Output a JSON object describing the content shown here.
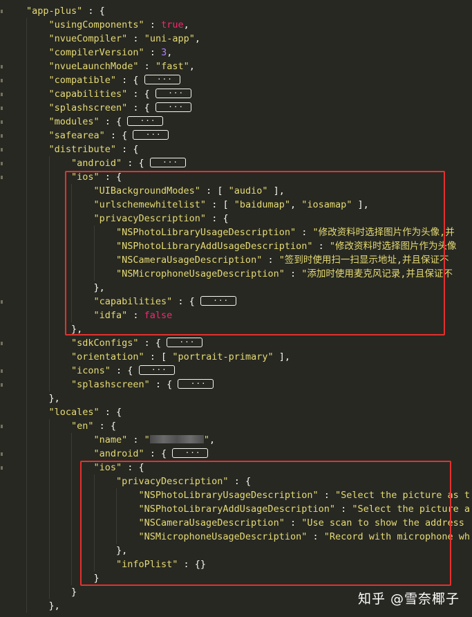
{
  "editor": {
    "theme": {
      "background": "#272822",
      "key": "#e6db74",
      "string": "#e6db74",
      "number": "#ae81ff",
      "keyword": "#f92672",
      "punctuation": "#f8f8f2",
      "highlight": "#e5312f"
    },
    "fold_marker": " ···",
    "lines": [
      {
        "indent": 1,
        "tokens": [
          {
            "c": "key",
            "v": "\"app-plus\""
          },
          {
            "c": "pun",
            "v": " : {"
          }
        ]
      },
      {
        "indent": 2,
        "tokens": [
          {
            "c": "key",
            "v": "\"usingComponents\""
          },
          {
            "c": "pun",
            "v": " : "
          },
          {
            "c": "kw",
            "v": "true"
          },
          {
            "c": "pun",
            "v": ","
          }
        ]
      },
      {
        "indent": 2,
        "tokens": [
          {
            "c": "key",
            "v": "\"nvueCompiler\""
          },
          {
            "c": "pun",
            "v": " : "
          },
          {
            "c": "str",
            "v": "\"uni-app\""
          },
          {
            "c": "pun",
            "v": ","
          }
        ]
      },
      {
        "indent": 2,
        "tokens": [
          {
            "c": "key",
            "v": "\"compilerVersion\""
          },
          {
            "c": "pun",
            "v": " : "
          },
          {
            "c": "num",
            "v": "3"
          },
          {
            "c": "pun",
            "v": ","
          }
        ]
      },
      {
        "indent": 2,
        "tokens": [
          {
            "c": "key",
            "v": "\"nvueLaunchMode\""
          },
          {
            "c": "pun",
            "v": " : "
          },
          {
            "c": "str",
            "v": "\"fast\""
          },
          {
            "c": "pun",
            "v": ","
          }
        ]
      },
      {
        "indent": 2,
        "tokens": [
          {
            "c": "key",
            "v": "\"compatible\""
          },
          {
            "c": "pun",
            "v": " : { "
          },
          {
            "c": "fold"
          }
        ]
      },
      {
        "indent": 2,
        "tokens": [
          {
            "c": "key",
            "v": "\"capabilities\""
          },
          {
            "c": "pun",
            "v": " : { "
          },
          {
            "c": "fold"
          }
        ]
      },
      {
        "indent": 2,
        "tokens": [
          {
            "c": "key",
            "v": "\"splashscreen\""
          },
          {
            "c": "pun",
            "v": " : { "
          },
          {
            "c": "fold"
          }
        ]
      },
      {
        "indent": 2,
        "tokens": [
          {
            "c": "key",
            "v": "\"modules\""
          },
          {
            "c": "pun",
            "v": " : { "
          },
          {
            "c": "fold"
          }
        ]
      },
      {
        "indent": 2,
        "tokens": [
          {
            "c": "key",
            "v": "\"safearea\""
          },
          {
            "c": "pun",
            "v": " : { "
          },
          {
            "c": "fold"
          }
        ]
      },
      {
        "indent": 2,
        "tokens": [
          {
            "c": "key",
            "v": "\"distribute\""
          },
          {
            "c": "pun",
            "v": " : {"
          }
        ]
      },
      {
        "indent": 3,
        "tokens": [
          {
            "c": "key",
            "v": "\"android\""
          },
          {
            "c": "pun",
            "v": " : { "
          },
          {
            "c": "fold"
          }
        ]
      },
      {
        "indent": 3,
        "tokens": [
          {
            "c": "key",
            "v": "\"ios\""
          },
          {
            "c": "pun",
            "v": " : {"
          }
        ]
      },
      {
        "indent": 4,
        "tokens": [
          {
            "c": "key",
            "v": "\"UIBackgroundModes\""
          },
          {
            "c": "pun",
            "v": " : [ "
          },
          {
            "c": "str",
            "v": "\"audio\""
          },
          {
            "c": "pun",
            "v": " ],"
          }
        ]
      },
      {
        "indent": 4,
        "tokens": [
          {
            "c": "key",
            "v": "\"urlschemewhitelist\""
          },
          {
            "c": "pun",
            "v": " : [ "
          },
          {
            "c": "str",
            "v": "\"baidumap\""
          },
          {
            "c": "pun",
            "v": ", "
          },
          {
            "c": "str",
            "v": "\"iosamap\""
          },
          {
            "c": "pun",
            "v": " ],"
          }
        ]
      },
      {
        "indent": 4,
        "tokens": [
          {
            "c": "key",
            "v": "\"privacyDescription\""
          },
          {
            "c": "pun",
            "v": " : {"
          }
        ]
      },
      {
        "indent": 5,
        "tokens": [
          {
            "c": "key",
            "v": "\"NSPhotoLibraryUsageDescription\""
          },
          {
            "c": "pun",
            "v": " : "
          },
          {
            "c": "str",
            "v": "\"修改资料时选择图片作为头像,并"
          }
        ]
      },
      {
        "indent": 5,
        "tokens": [
          {
            "c": "key",
            "v": "\"NSPhotoLibraryAddUsageDescription\""
          },
          {
            "c": "pun",
            "v": " : "
          },
          {
            "c": "str",
            "v": "\"修改资料时选择图片作为头像"
          }
        ]
      },
      {
        "indent": 5,
        "tokens": [
          {
            "c": "key",
            "v": "\"NSCameraUsageDescription\""
          },
          {
            "c": "pun",
            "v": " : "
          },
          {
            "c": "str",
            "v": "\"签到时使用扫一扫显示地址,并且保证不"
          }
        ]
      },
      {
        "indent": 5,
        "tokens": [
          {
            "c": "key",
            "v": "\"NSMicrophoneUsageDescription\""
          },
          {
            "c": "pun",
            "v": " : "
          },
          {
            "c": "str",
            "v": "\"添加时使用麦克风记录,并且保证不"
          }
        ]
      },
      {
        "indent": 4,
        "tokens": [
          {
            "c": "pun",
            "v": "},"
          }
        ]
      },
      {
        "indent": 4,
        "tokens": [
          {
            "c": "key",
            "v": "\"capabilities\""
          },
          {
            "c": "pun",
            "v": " : { "
          },
          {
            "c": "fold"
          }
        ]
      },
      {
        "indent": 4,
        "tokens": [
          {
            "c": "key",
            "v": "\"idfa\""
          },
          {
            "c": "pun",
            "v": " : "
          },
          {
            "c": "kw",
            "v": "false"
          }
        ]
      },
      {
        "indent": 3,
        "tokens": [
          {
            "c": "pun",
            "v": "},"
          }
        ]
      },
      {
        "indent": 3,
        "tokens": [
          {
            "c": "key",
            "v": "\"sdkConfigs\""
          },
          {
            "c": "pun",
            "v": " : { "
          },
          {
            "c": "fold"
          }
        ]
      },
      {
        "indent": 3,
        "tokens": [
          {
            "c": "key",
            "v": "\"orientation\""
          },
          {
            "c": "pun",
            "v": " : [ "
          },
          {
            "c": "str",
            "v": "\"portrait-primary\""
          },
          {
            "c": "pun",
            "v": " ],"
          }
        ]
      },
      {
        "indent": 3,
        "tokens": [
          {
            "c": "key",
            "v": "\"icons\""
          },
          {
            "c": "pun",
            "v": " : { "
          },
          {
            "c": "fold"
          }
        ]
      },
      {
        "indent": 3,
        "tokens": [
          {
            "c": "key",
            "v": "\"splashscreen\""
          },
          {
            "c": "pun",
            "v": " : { "
          },
          {
            "c": "fold"
          }
        ]
      },
      {
        "indent": 2,
        "tokens": [
          {
            "c": "pun",
            "v": "},"
          }
        ]
      },
      {
        "indent": 2,
        "tokens": [
          {
            "c": "key",
            "v": "\"locales\""
          },
          {
            "c": "pun",
            "v": " : {"
          }
        ]
      },
      {
        "indent": 3,
        "tokens": [
          {
            "c": "key",
            "v": "\"en\""
          },
          {
            "c": "pun",
            "v": " : {"
          }
        ]
      },
      {
        "indent": 4,
        "tokens": [
          {
            "c": "key",
            "v": "\"name\""
          },
          {
            "c": "pun",
            "v": " : "
          },
          {
            "c": "str",
            "v": "\""
          },
          {
            "c": "blur"
          },
          {
            "c": "str",
            "v": "\""
          },
          {
            "c": "pun",
            "v": ","
          }
        ]
      },
      {
        "indent": 4,
        "tokens": [
          {
            "c": "key",
            "v": "\"android\""
          },
          {
            "c": "pun",
            "v": " : { "
          },
          {
            "c": "fold"
          }
        ]
      },
      {
        "indent": 4,
        "tokens": [
          {
            "c": "key",
            "v": "\"ios\""
          },
          {
            "c": "pun",
            "v": " : {"
          }
        ]
      },
      {
        "indent": 5,
        "tokens": [
          {
            "c": "key",
            "v": "\"privacyDescription\""
          },
          {
            "c": "pun",
            "v": " : {"
          }
        ]
      },
      {
        "indent": 6,
        "tokens": [
          {
            "c": "key",
            "v": "\"NSPhotoLibraryUsageDescription\""
          },
          {
            "c": "pun",
            "v": " : "
          },
          {
            "c": "str",
            "v": "\"Select the picture as t"
          }
        ]
      },
      {
        "indent": 6,
        "tokens": [
          {
            "c": "key",
            "v": "\"NSPhotoLibraryAddUsageDescription\""
          },
          {
            "c": "pun",
            "v": " : "
          },
          {
            "c": "str",
            "v": "\"Select the picture a"
          }
        ]
      },
      {
        "indent": 6,
        "tokens": [
          {
            "c": "key",
            "v": "\"NSCameraUsageDescription\""
          },
          {
            "c": "pun",
            "v": " : "
          },
          {
            "c": "str",
            "v": "\"Use scan to show the address"
          }
        ]
      },
      {
        "indent": 6,
        "tokens": [
          {
            "c": "key",
            "v": "\"NSMicrophoneUsageDescription\""
          },
          {
            "c": "pun",
            "v": " : "
          },
          {
            "c": "str",
            "v": "\"Record with microphone wh"
          }
        ]
      },
      {
        "indent": 5,
        "tokens": [
          {
            "c": "pun",
            "v": "},"
          }
        ]
      },
      {
        "indent": 5,
        "tokens": [
          {
            "c": "key",
            "v": "\"infoPlist\""
          },
          {
            "c": "pun",
            "v": " : {}"
          }
        ]
      },
      {
        "indent": 4,
        "tokens": [
          {
            "c": "pun",
            "v": "}"
          }
        ]
      },
      {
        "indent": 3,
        "tokens": [
          {
            "c": "pun",
            "v": "}"
          }
        ]
      },
      {
        "indent": 2,
        "tokens": [
          {
            "c": "pun",
            "v": "},"
          }
        ]
      }
    ]
  },
  "watermark": {
    "text": "知乎 @雪奈椰子"
  }
}
